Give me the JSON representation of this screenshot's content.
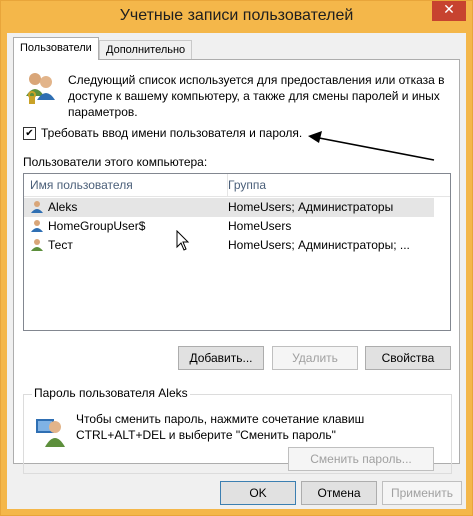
{
  "window": {
    "title": "Учетные записи пользователей",
    "close_symbol": "✕"
  },
  "tabs": [
    {
      "label": "Пользователи"
    },
    {
      "label": "Дополнительно"
    }
  ],
  "description": "Следующий список используется для предоставления или отказа в доступе к вашему компьютеру, а также для смены паролей и иных параметров.",
  "require_login": {
    "label": "Требовать ввод имени пользователя и пароля.",
    "checked": true,
    "check_symbol": "✔"
  },
  "users_section": {
    "label": "Пользователи этого компьютера:",
    "columns": [
      "Имя пользователя",
      "Группа"
    ],
    "rows": [
      {
        "name": "Aleks",
        "group": "HomeUsers; Администраторы",
        "selected": true
      },
      {
        "name": "HomeGroupUser$",
        "group": "HomeUsers",
        "selected": false
      },
      {
        "name": "Тест",
        "group": "HomeUsers; Администраторы; ...",
        "selected": false
      }
    ]
  },
  "user_buttons": {
    "add": "Добавить...",
    "remove": "Удалить",
    "properties": "Свойства"
  },
  "password_group": {
    "title": "Пароль пользователя Aleks",
    "text": "Чтобы сменить пароль, нажмите сочетание клавиш CTRL+ALT+DEL и выберите \"Сменить пароль\"",
    "button": "Сменить пароль..."
  },
  "dialog_buttons": {
    "ok": "OK",
    "cancel": "Отмена",
    "apply": "Применить"
  },
  "colors": {
    "title_bar": "#f4b74a",
    "close_button": "#c7432f",
    "selection": "#e5e5e5",
    "annotation_arrow": "#000000"
  },
  "icons": [
    "users-icon",
    "user-icon",
    "key-icon",
    "mouse-cursor-icon",
    "annotation-arrow-icon"
  ]
}
